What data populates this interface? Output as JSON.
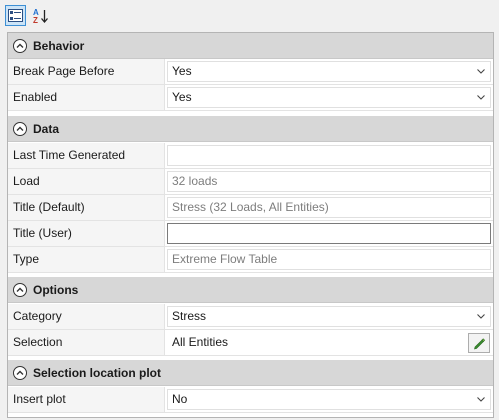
{
  "toolbar": {
    "categorized_icon": "categorized-view-icon",
    "alphabetical_icon": "sort-az-icon"
  },
  "categories": [
    {
      "name": "Behavior",
      "rows": [
        {
          "label": "Break Page Before",
          "value": "Yes",
          "kind": "combo"
        },
        {
          "label": "Enabled",
          "value": "Yes",
          "kind": "combo"
        }
      ]
    },
    {
      "name": "Data",
      "rows": [
        {
          "label": "Last Time Generated",
          "value": "",
          "kind": "readonly"
        },
        {
          "label": "Load",
          "value": "32 loads",
          "kind": "readonly"
        },
        {
          "label": "Title (Default)",
          "value": "Stress (32 Loads, All Entities)",
          "kind": "readonly"
        },
        {
          "label": "Title (User)",
          "value": "",
          "kind": "edit"
        },
        {
          "label": "Type",
          "value": "Extreme Flow Table",
          "kind": "readonly"
        }
      ]
    },
    {
      "name": "Options",
      "rows": [
        {
          "label": "Category",
          "value": "Stress",
          "kind": "combo"
        },
        {
          "label": "Selection",
          "value": "All Entities",
          "kind": "button",
          "button_icon": "pencil-icon"
        }
      ]
    },
    {
      "name": "Selection location plot",
      "rows": [
        {
          "label": "Insert plot",
          "value": "No",
          "kind": "combo"
        }
      ]
    }
  ],
  "colors": {
    "category_bg": "#d7d7d7",
    "label_bg": "#f5f5f5",
    "toolbar_active_bg": "#cce4f7",
    "toolbar_active_border": "#3d8fd4",
    "pencil_green": "#3a8c2f"
  }
}
